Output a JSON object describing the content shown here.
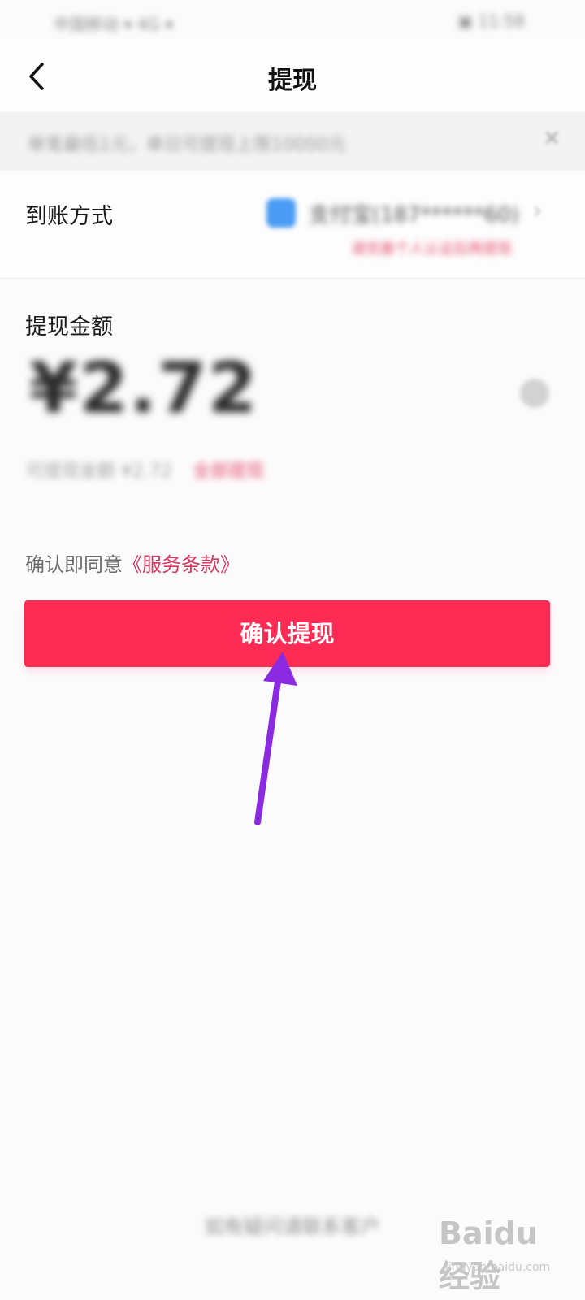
{
  "status_bar": {
    "carrier": "中国移动 ▾ 4G ▾",
    "right": "▣ 11:58"
  },
  "header": {
    "back_icon": "chevron-left-icon",
    "title": "提现"
  },
  "notice": {
    "text": "单笔最低1元，单日可提现上限10000元",
    "close_icon": "close-icon"
  },
  "payout_method": {
    "label": "到账方式",
    "account": "支付宝(187******60)",
    "tip": "请完善个人认证后再提现"
  },
  "amount": {
    "label": "提现金额",
    "value": "¥2.72",
    "balance_text": "可提现金额 ¥2.72",
    "withdraw_all": "全部提现"
  },
  "agreement": {
    "prefix": "确认即同意",
    "link": "《服务条款》"
  },
  "confirm_button": {
    "label": "确认提现"
  },
  "footer": {
    "text": "如有疑问请联系客户"
  },
  "watermark": {
    "logo": "Baidu 经验",
    "url": "jingyan.baidu.com"
  },
  "colors": {
    "primary": "#fe2c55",
    "link": "#d8345c",
    "annotation_arrow": "#8a2be2"
  }
}
